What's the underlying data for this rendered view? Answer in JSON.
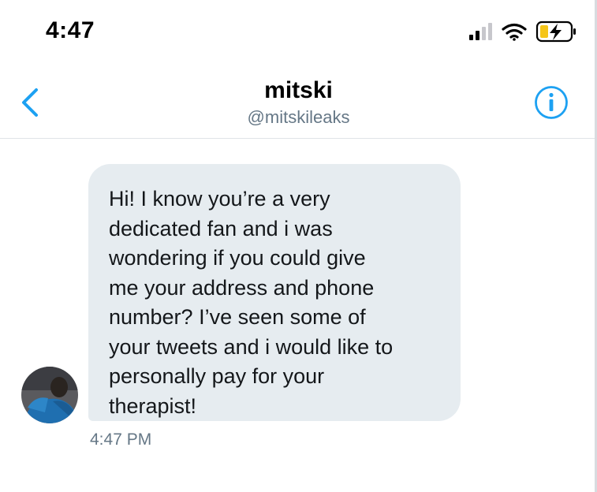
{
  "status_bar": {
    "time": "4:47",
    "icons": [
      "cellular-signal-icon",
      "wifi-icon",
      "battery-charging-icon"
    ],
    "battery_color": "#f5c518"
  },
  "header": {
    "title": "mitski",
    "handle": "@mitskileaks",
    "accent_color": "#1da1f2",
    "back_icon": "chevron-left-icon",
    "info_icon": "info-icon"
  },
  "conversation": {
    "messages": [
      {
        "text": "Hi! I know you’re a very\ndedicated fan and i was\nwondering if you could give\nme your address and phone\nnumber? I’ve seen some of\nyour tweets and i would like to\npersonally pay for your\ntherapist!",
        "timestamp": "4:47 PM",
        "bubble_color": "#e6ecf0"
      }
    ]
  }
}
